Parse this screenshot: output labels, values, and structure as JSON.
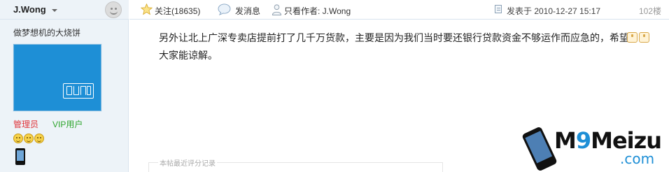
{
  "author": {
    "name": "J.Wong",
    "title": "做梦想机的大烧饼",
    "role": "管理员",
    "group": "VIP用户"
  },
  "header": {
    "follow_label": "关注(18635)",
    "message_label": "发消息",
    "only_author_label": "只看作者: J.Wong",
    "posted_label": "发表于 2010-12-27 15:17",
    "floor_label": "102楼"
  },
  "post": {
    "body": "另外让北上广深专卖店提前打了几千万货款，主要是因为我们当时要还银行贷款资金不够运作而应急的，希望大家能谅解。",
    "rating_label": "本帖最近评分记录"
  },
  "watermark": {
    "brand_m": "M",
    "brand_9": "9",
    "brand_rest": "Meizu",
    "domain": ".com"
  },
  "colors": {
    "accent": "#1e8fd6",
    "admin_red": "#e0343a",
    "vip_green": "#2ea52e",
    "sidebar_bg": "#edf3f8"
  },
  "icons": [
    "chevron-down-icon",
    "online-status-icon",
    "star-icon",
    "message-bubble-icon",
    "person-icon",
    "document-icon",
    "thumbs-up-icon",
    "medal-icon",
    "phone-badge-icon"
  ]
}
